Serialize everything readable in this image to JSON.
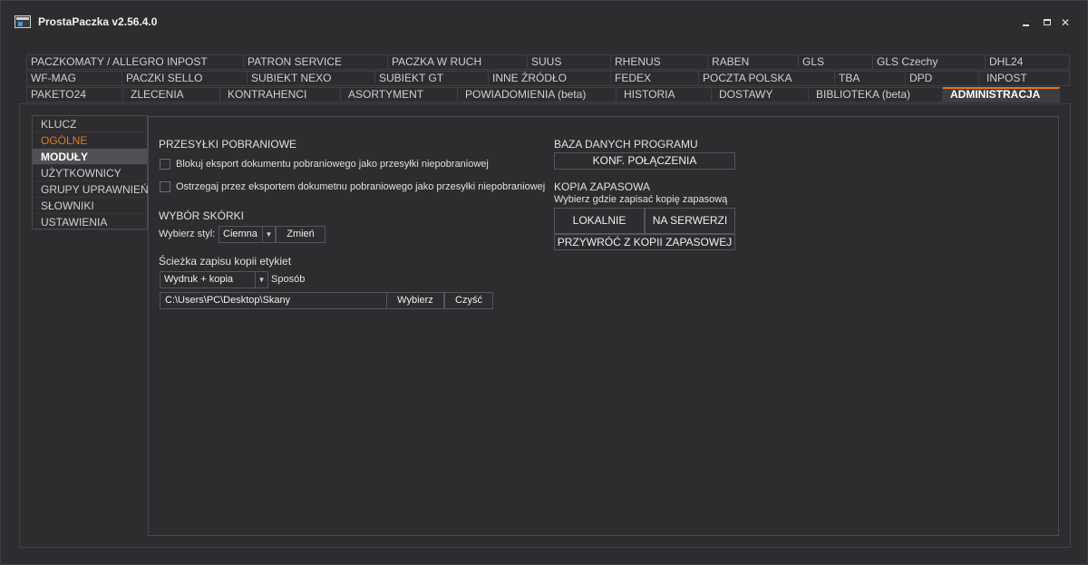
{
  "window": {
    "title": "ProstaPaczka v2.56.4.0",
    "minimize_icon": "minimize-icon",
    "maximize_icon": "maximize-icon",
    "close_label": "✕"
  },
  "tabs": {
    "row1": [
      "PACZKOMATY / ALLEGRO INPOST",
      "PATRON SERVICE",
      "PACZKA W RUCH",
      "SUUS",
      "RHENUS",
      "RABEN",
      "GLS",
      "GLS Czechy",
      "DHL24"
    ],
    "row2": [
      "WF-MAG",
      "PACZKI SELLO",
      "SUBIEKT NEXO",
      "SUBIEKT GT",
      "INNE ŹRÓDŁO",
      "FEDEX",
      "POCZTA POLSKA",
      "TBA",
      "DPD",
      "INPOST"
    ],
    "row3": [
      "PAKETO24",
      "ZLECENIA",
      "KONTRAHENCI",
      "ASORTYMENT",
      "POWIADOMIENIA (beta)",
      "HISTORIA",
      "DOSTAWY",
      "BIBLIOTEKA (beta)",
      "ADMINISTRACJA"
    ],
    "active": "ADMINISTRACJA"
  },
  "sidebar": {
    "items": [
      "KLUCZ",
      "OGÓLNE",
      "MODUŁY",
      "UŻYTKOWNICY",
      "GRUPY UPRAWNIEŃ",
      "SŁOWNIKI",
      "USTAWIENIA"
    ],
    "active": "OGÓLNE",
    "selected": "MODUŁY"
  },
  "cod": {
    "title": "PRZESYŁKI POBRANIOWE",
    "option1": "Blokuj eksport dokumentu pobraniowego jako przesyłki niepobraniowej",
    "option2": "Ostrzegaj przez eksportem dokumetnu pobraniowego jako przesyłki niepobraniowej",
    "option1_checked": false,
    "option2_checked": false
  },
  "skin": {
    "title": "WYBÓR SKÓRKI",
    "label": "Wybierz styl:",
    "value": "Ciemna",
    "change_button": "Zmień"
  },
  "labels_path": {
    "title": "Ścieżka zapisu kopii etykiet",
    "mode_value": "Wydruk + kopia",
    "mode_label": "Sposób",
    "path_value": "C:\\Users\\PC\\Desktop\\Skany",
    "choose_button": "Wybierz",
    "clear_button": "Czyść"
  },
  "database": {
    "title": "BAZA DANYCH PROGRAMU",
    "config_button": "KONF. POŁĄCZENIA"
  },
  "backup": {
    "title": "KOPIA ZAPASOWA",
    "subtitle": "Wybierz gdzie zapisać kopię zapasową",
    "local_button": "LOKALNIE",
    "server_button": "NA SERWERZI",
    "restore_button": "PRZYWRÓĆ Z KOPII ZAPASOWEJ"
  },
  "colors": {
    "background": "#2d2d30",
    "accent": "#e07a1f",
    "selected": "#505055"
  }
}
